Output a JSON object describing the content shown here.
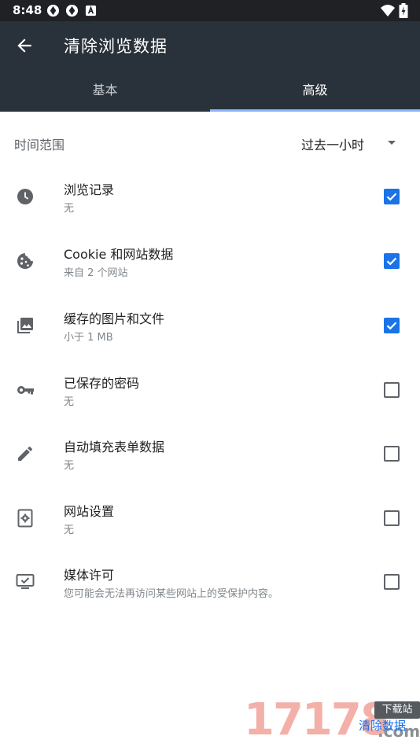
{
  "status_bar": {
    "time": "8:48",
    "icons": [
      "notification-icon",
      "notification-icon",
      "notification-icon"
    ],
    "right_icons": [
      "wifi-icon",
      "battery-icon"
    ]
  },
  "app_bar": {
    "back_icon": "arrow-left-icon",
    "title": "清除浏览数据"
  },
  "tabs": [
    {
      "label": "基本",
      "active": false
    },
    {
      "label": "高级",
      "active": true
    }
  ],
  "time_range": {
    "label": "时间范围",
    "value": "过去一小时"
  },
  "items": [
    {
      "icon": "clock-icon",
      "title": "浏览记录",
      "subtitle": "无",
      "checked": true
    },
    {
      "icon": "cookie-icon",
      "title": "Cookie 和网站数据",
      "subtitle": "来自 2 个网站",
      "checked": true
    },
    {
      "icon": "image-icon",
      "title": "缓存的图片和文件",
      "subtitle": "小于 1 MB",
      "checked": true
    },
    {
      "icon": "key-icon",
      "title": "已保存的密码",
      "subtitle": "无",
      "checked": false
    },
    {
      "icon": "pencil-icon",
      "title": "自动填充表单数据",
      "subtitle": "无",
      "checked": false
    },
    {
      "icon": "site-settings-icon",
      "title": "网站设置",
      "subtitle": "无",
      "checked": false
    },
    {
      "icon": "monitor-check-icon",
      "title": "媒体许可",
      "subtitle": "您可能会无法再访问某些网站上的受保护内容。",
      "checked": false
    }
  ],
  "watermark": {
    "number": "17178",
    "badge": "下载站",
    "domain": ".com",
    "overlay_text": "清除数据"
  },
  "colors": {
    "toolbar": "#29313a",
    "status_bar": "#202124",
    "accent": "#1a73e8",
    "tab_indicator": "#8ab4f8"
  }
}
